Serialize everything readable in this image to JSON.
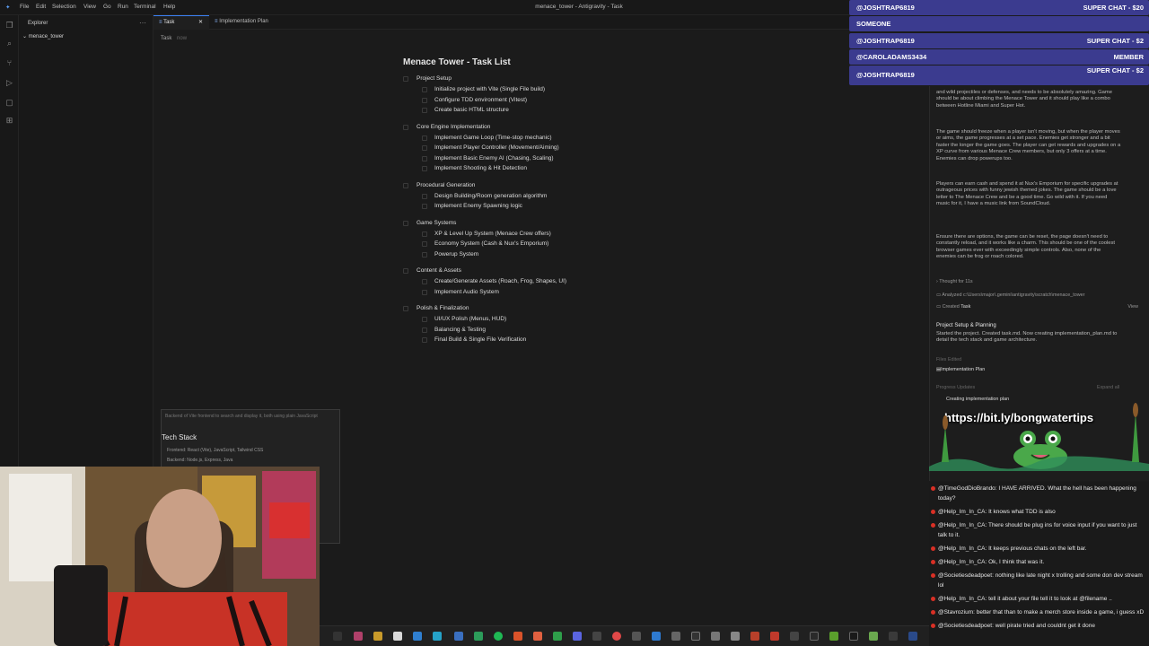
{
  "window": {
    "title": "menace_tower - Antigravity - Task"
  },
  "menu": [
    "File",
    "Edit",
    "Selection",
    "View",
    "Go",
    "Run",
    "Terminal",
    "Help"
  ],
  "sidebar": {
    "title": "Explorer",
    "folder": "menace_tower"
  },
  "tabs": [
    {
      "label": "Task"
    },
    {
      "label": "Implementation Plan"
    }
  ],
  "breadcrumb": {
    "label": "Task",
    "sub": "now"
  },
  "document": {
    "title": "Menace Tower - Task List",
    "sections": [
      {
        "label": "Project Setup",
        "items": [
          "Initialize project with Vite (Single File build)",
          "Configure TDD environment (Vitest)",
          "Create basic HTML structure"
        ]
      },
      {
        "label": "Core Engine Implementation",
        "items": [
          "Implement Game Loop (Time-stop mechanic)",
          "Implement Player Controller (Movement/Aiming)",
          "Implement Basic Enemy AI (Chasing, Scaling)",
          "Implement Shooting & Hit Detection"
        ]
      },
      {
        "label": "Procedural Generation",
        "items": [
          "Design Building/Room generation algorithm",
          "Implement Enemy Spawning logic"
        ]
      },
      {
        "label": "Game Systems",
        "items": [
          "XP & Level Up System (Menace Crew offers)",
          "Economy System (Cash & Nux's Emporium)",
          "Powerup System"
        ]
      },
      {
        "label": "Content & Assets",
        "items": [
          "Create/Generate Assets (Roach, Frog, Shapes, UI)",
          "Implement Audio System"
        ]
      },
      {
        "label": "Polish & Finalization",
        "items": [
          "UI/UX Polish (Menus, HUD)",
          "Balancing & Testing",
          "Final Build & Single File Verification"
        ]
      }
    ]
  },
  "agent_panel": {
    "p1": "and wild projectiles or defenses, and needs to be absolutely amazing. Game should be about climbing the Menace Tower and it should play like a combo between Hotline Miami and Super Hot.",
    "p2": "The game should freeze when a player isn't moving, but when the player moves or aims, the game progresses at a set pace. Enemies get stronger and a bit faster the longer the game goes. The player can get rewards and upgrades on a XP curve from various Menace Crew members, but only 3 offers at a time. Enemies can drop powerups too.",
    "p3": "Players can earn cash and spend it at Nux's Emporium for specific upgrades at outrageous prices with funny jewish themed jokes. The game should be a love letter to The Menace Crew and be a good time. Go wild with it. If you need music for it, I have a music link from SoundCloud.",
    "p4": "Ensure there are options, the game can be reset, the page doesn't need to constantly reload, and it works like a charm. This should be one of the coolest browser games ever with exceedingly simple controls. Also, none of the enemies can be frog or roach colored.",
    "thought": "Thought for 11s",
    "analyzed": "Analyzed c:\\Users\\major\\.gemini\\antigravity\\scratch\\menace_tower",
    "created": "Created",
    "created_file": "Task",
    "created_view": "View",
    "setup_title": "Project Setup & Planning",
    "setup_text": "Started the project. Created task.md. Now creating implementation_plan.md to detail the tech stack and game architecture.",
    "files_edited": "Files Edited",
    "file_impl": "Implementation Plan",
    "progress": "Progress Updates",
    "expand_all": "Expand all",
    "creating": "Creating implementation plan"
  },
  "overlay": {
    "url": "https://bit.ly/bongwatertips"
  },
  "alerts": [
    {
      "user": "@JOSHTRAP6819",
      "amount": "SUPER CHAT - $20",
      "color": "#3b3b8f"
    },
    {
      "user": "SOMEONE",
      "amount": "",
      "color": "#3b3b8f"
    },
    {
      "user": "@JOSHTRAP6819",
      "amount": "SUPER CHAT - $2",
      "color": "#3b3b8f"
    },
    {
      "user": "@CAROLADAMS3434",
      "amount": "MEMBER",
      "color": "#3b3b8f"
    },
    {
      "user": "@JOSHTRAP6819",
      "amount": "SUPER CHAT - $2",
      "color": "#3b3b8f"
    }
  ],
  "chat": [
    {
      "text": "@TimeGodDioBrando: I HAVE ARRIVED. What the hell has been happening today?"
    },
    {
      "text": "@Help_Im_In_CA: It knows what TDD is also"
    },
    {
      "text": "@Help_Im_In_CA: There should be plug ins for voice input if you want to just talk to it."
    },
    {
      "text": "@Help_Im_In_CA: It keeps previous chats on the left bar."
    },
    {
      "text": "@Help_Im_In_CA: Ok, I think that was it."
    },
    {
      "text": "@Societiesdeadpoet: nothing like late night x trolling and some don dev stream lol"
    },
    {
      "text": "@Help_Im_In_CA: tell it about your file tell it to look at @filename .."
    },
    {
      "text": "@Stavrozium: better that than to make a merch store inside a game, i guess xD"
    },
    {
      "text": "@Societiesdeadpoet: well pirate tried and couldnt get it done"
    }
  ],
  "techcard": {
    "title": "Tech Stack",
    "line1": "Frontend: React (Vite), JavaScript, Tailwind CSS",
    "line2": "Backend: Node.js, Express, Java",
    "top": "Backend of Vite frontend to search and display it, both using plain JavaScript"
  }
}
